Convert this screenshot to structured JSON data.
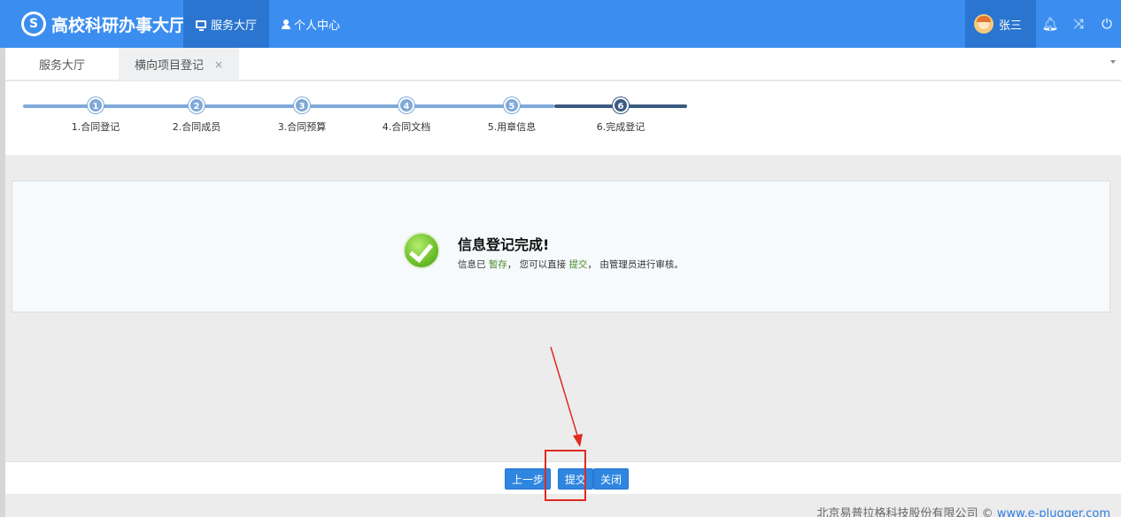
{
  "app": {
    "logo_glyph": "S",
    "title": "高校科研办事大厅"
  },
  "nav": [
    {
      "label": "服务大厅",
      "icon": "monitor-icon",
      "active": true
    },
    {
      "label": "个人中心",
      "icon": "user-icon",
      "active": false
    }
  ],
  "user": {
    "name": "张三",
    "avatar": "avatar-icon"
  },
  "toolbar_icons": [
    {
      "name": "bell-icon",
      "glyph": "🔔︎"
    },
    {
      "name": "shuffle-icon",
      "glyph": "⤨"
    },
    {
      "name": "power-icon",
      "glyph": "⏻"
    }
  ],
  "tabs": [
    {
      "label": "服务大厅",
      "closable": false
    },
    {
      "label": "横向项目登记",
      "closable": true,
      "close_glyph": "×"
    }
  ],
  "steps": [
    {
      "num": "1",
      "label": "1.合同登记"
    },
    {
      "num": "2",
      "label": "2.合同成员"
    },
    {
      "num": "3",
      "label": "3.合同预算"
    },
    {
      "num": "4",
      "label": "4.合同文档"
    },
    {
      "num": "5",
      "label": "5.用章信息"
    },
    {
      "num": "6",
      "label": "6.完成登记",
      "current": true
    }
  ],
  "result": {
    "title": "信息登记完成!",
    "body_prefix": "信息已 ",
    "body_link1": "暂存",
    "body_mid": "， 您可以直接 ",
    "body_link2": "提交",
    "body_suffix": "， 由管理员进行审核。"
  },
  "buttons": {
    "prev": "上一步",
    "submit": "提交",
    "close": "关闭"
  },
  "footer": {
    "company": "北京易普拉格科技股份有限公司 © ",
    "url": "www.e-plugger.com"
  },
  "colors": {
    "topbar": "#3b8ef0",
    "nav_active": "#2a75d0",
    "step_done": "#7fa9d8",
    "step_current": "#3a5a82",
    "button": "#2f86e0",
    "annotation": "#e02a20"
  }
}
